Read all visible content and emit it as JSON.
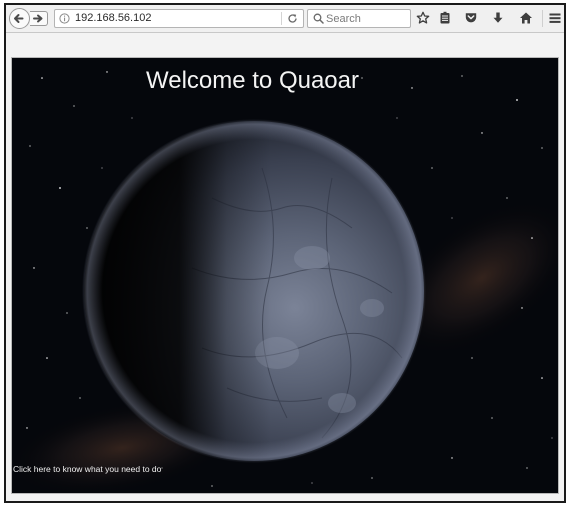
{
  "browser": {
    "url": "192.168.56.102",
    "search_placeholder": "Search"
  },
  "page": {
    "title": "Welcome to Quaoar",
    "link_text": "Click here to know what you need to do"
  },
  "toolbar_icons": [
    "back-icon",
    "forward-icon",
    "info-icon",
    "reload-icon",
    "search-icon",
    "bookmark-star-icon",
    "reading-list-icon",
    "pocket-icon",
    "download-icon",
    "home-icon",
    "menu-icon"
  ],
  "colors": {
    "space_background": "#05070c",
    "planet": "#4a5268",
    "title_text": "#f4f4f4"
  }
}
